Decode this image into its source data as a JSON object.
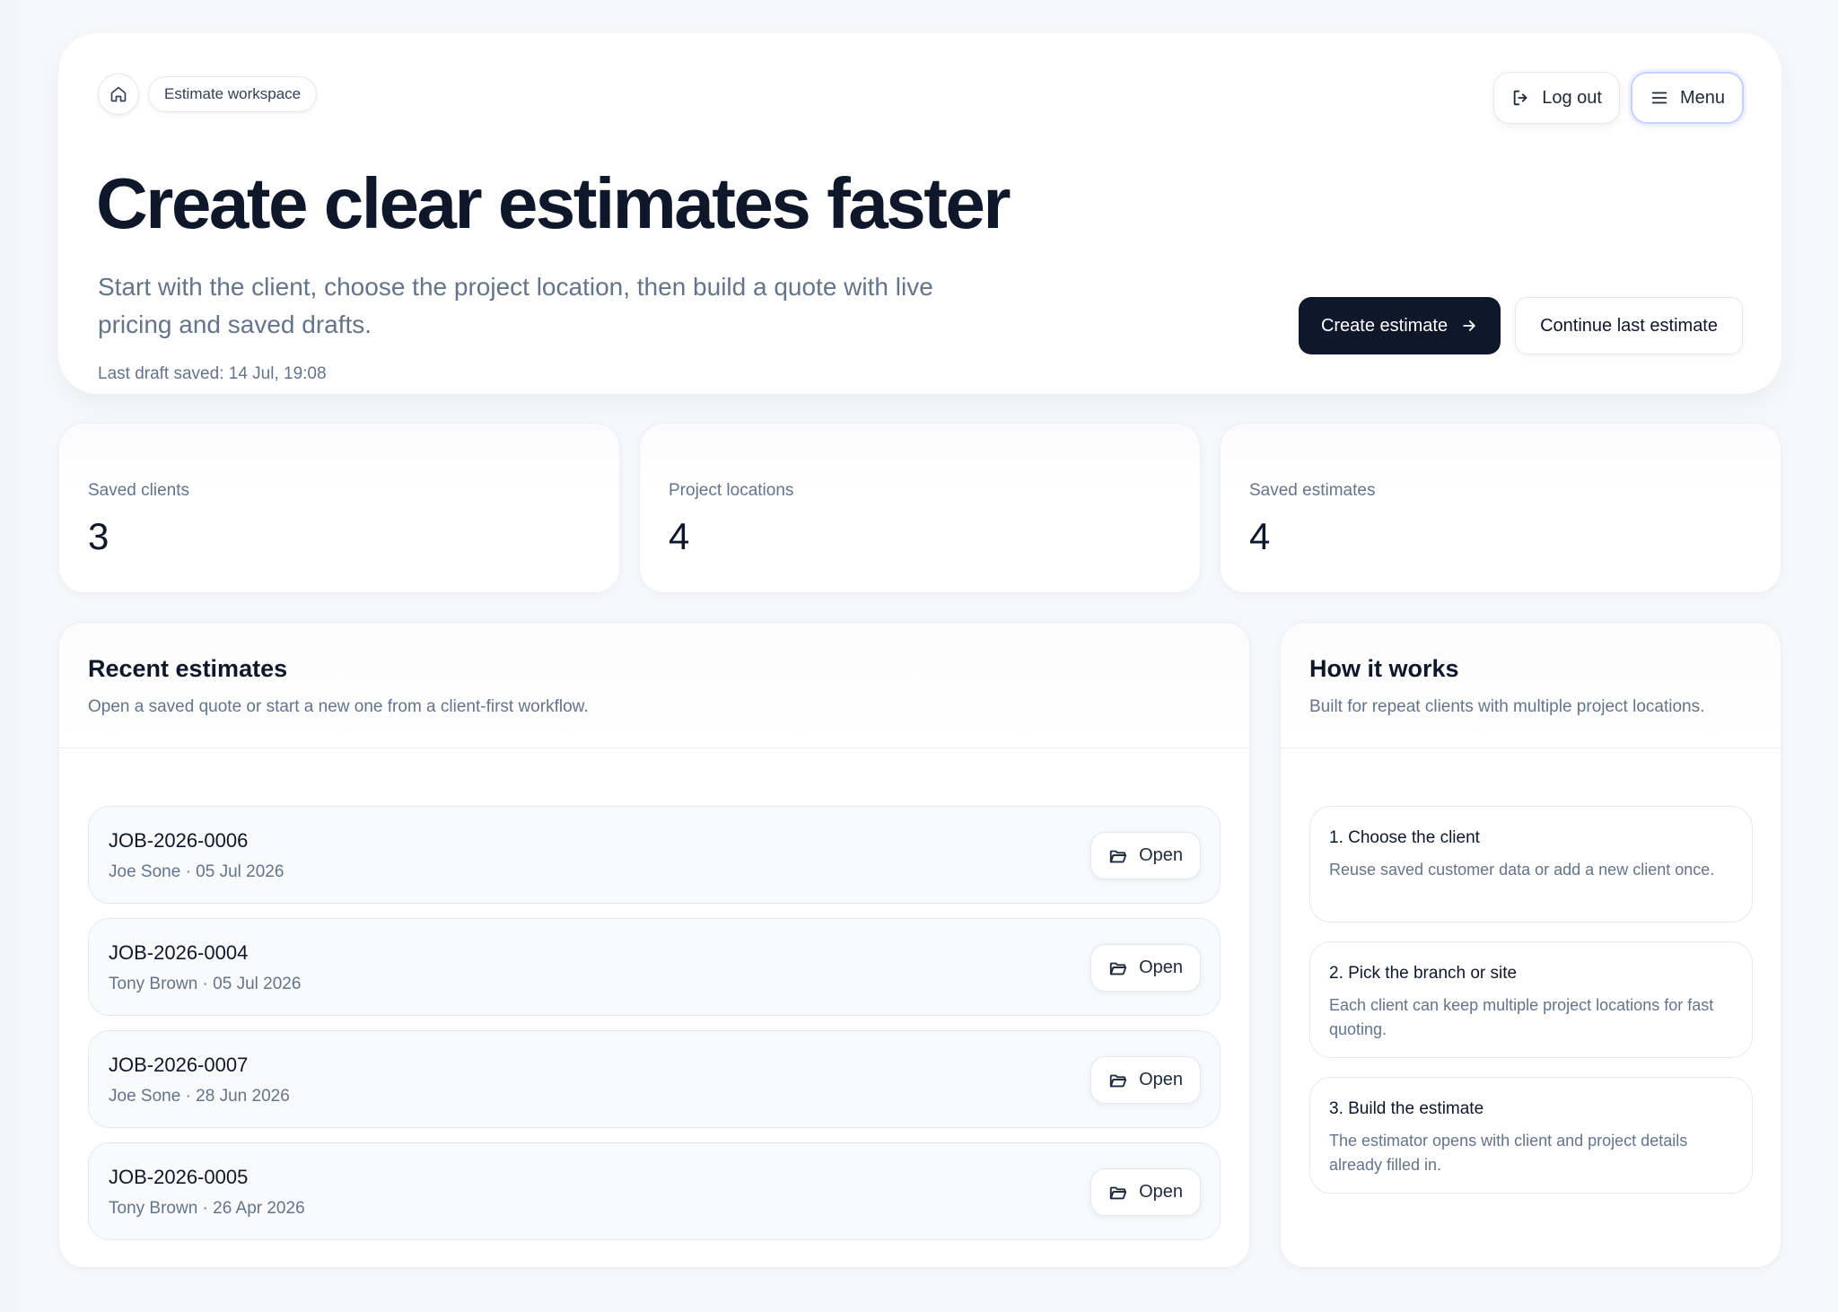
{
  "breadcrumb": {
    "home_icon": "home-icon",
    "workspace_label": "Estimate workspace"
  },
  "top_actions": {
    "logout_label": "Log out",
    "logout_icon": "log-out-icon",
    "menu_label": "Menu",
    "menu_icon": "hamburger-icon"
  },
  "hero": {
    "title": "Create clear estimates faster",
    "subtitle": "Start with the client, choose the project location, then build a quote with live pricing and saved drafts.",
    "last_saved": "Last draft saved: 14 Jul, 19:08",
    "create_label": "Create estimate",
    "continue_label": "Continue last estimate"
  },
  "stats": [
    {
      "label": "Saved clients",
      "value": "3"
    },
    {
      "label": "Project locations",
      "value": "4"
    },
    {
      "label": "Saved estimates",
      "value": "4"
    }
  ],
  "recent": {
    "title": "Recent estimates",
    "description": "Open a saved quote or start a new one from a client-first workflow.",
    "open_label": "Open",
    "items": [
      {
        "id": "JOB-2026-0006",
        "meta": "Joe Sone · 05 Jul 2026"
      },
      {
        "id": "JOB-2026-0004",
        "meta": "Tony Brown · 05 Jul 2026"
      },
      {
        "id": "JOB-2026-0007",
        "meta": "Joe Sone · 28 Jun 2026"
      },
      {
        "id": "JOB-2026-0005",
        "meta": "Tony Brown · 26 Apr 2026"
      }
    ]
  },
  "how": {
    "title": "How it works",
    "description": "Built for repeat clients with multiple project locations.",
    "steps": [
      {
        "title": "1. Choose the client",
        "desc": "Reuse saved customer data or add a new client once."
      },
      {
        "title": "2. Pick the branch or site",
        "desc": "Each client can keep multiple project locations for fast quoting."
      },
      {
        "title": "3. Build the estimate",
        "desc": "The estimator opens with client and project details already filled in."
      }
    ]
  },
  "colors": {
    "primary": "#0f172a",
    "muted": "#64748b",
    "border": "#e5e9ef",
    "background": "#f3f5f8"
  }
}
